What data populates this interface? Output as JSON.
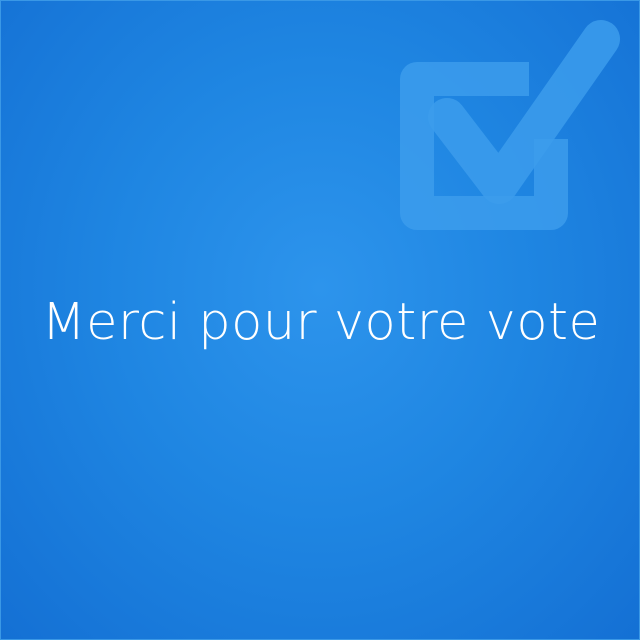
{
  "message": {
    "text": "Merci pour votre vote"
  },
  "icons": {
    "confirmation": "checkbox-check-icon"
  },
  "colors": {
    "background": "#1f86e2",
    "icon": "#3c9cec",
    "text": "#ffffff"
  }
}
